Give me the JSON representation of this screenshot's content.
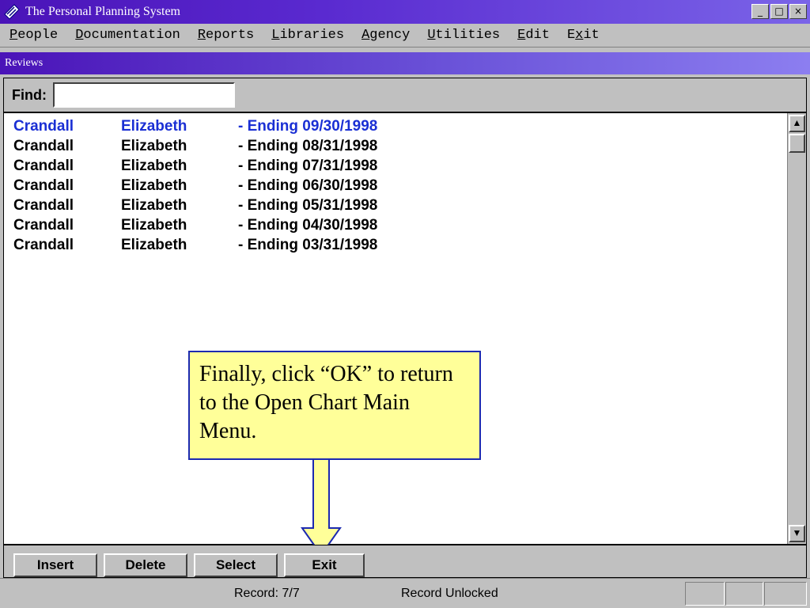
{
  "window": {
    "title": "The Personal Planning System",
    "controls": [
      "_",
      "□",
      "×"
    ]
  },
  "menu": [
    {
      "accel": "P",
      "rest": "eople"
    },
    {
      "accel": "D",
      "rest": "ocumentation"
    },
    {
      "accel": "R",
      "rest": "eports"
    },
    {
      "accel": "L",
      "rest": "ibraries"
    },
    {
      "accel": "A",
      "rest": "gency"
    },
    {
      "accel": "U",
      "rest": "tilities"
    },
    {
      "accel": "E",
      "rest": "dit"
    },
    {
      "pre": "E",
      "accel": "x",
      "rest": "it"
    }
  ],
  "child_window": {
    "title": "Reviews"
  },
  "find": {
    "label": "Find:",
    "value": ""
  },
  "rows": [
    {
      "last": "Crandall",
      "first": "Elizabeth",
      "period": "- Ending 09/30/1998",
      "selected": true
    },
    {
      "last": "Crandall",
      "first": "Elizabeth",
      "period": "- Ending 08/31/1998",
      "selected": false
    },
    {
      "last": "Crandall",
      "first": "Elizabeth",
      "period": "- Ending 07/31/1998",
      "selected": false
    },
    {
      "last": "Crandall",
      "first": "Elizabeth",
      "period": "- Ending 06/30/1998",
      "selected": false
    },
    {
      "last": "Crandall",
      "first": "Elizabeth",
      "period": "- Ending 05/31/1998",
      "selected": false
    },
    {
      "last": "Crandall",
      "first": "Elizabeth",
      "period": "- Ending 04/30/1998",
      "selected": false
    },
    {
      "last": "Crandall",
      "first": "Elizabeth",
      "period": "- Ending 03/31/1998",
      "selected": false
    }
  ],
  "scrollbar": {
    "up": "▲",
    "down": "▼"
  },
  "callout": {
    "text": "Finally, click “OK” to return to the Open Chart Main Menu."
  },
  "buttons": {
    "insert": "Insert",
    "delete": "Delete",
    "select": "Select",
    "exit": "Exit"
  },
  "status": {
    "record": "Record: 7/7",
    "lock": "Record Unlocked"
  },
  "colors": {
    "selected_row": "#1a2fd4",
    "callout_bg": "#ffff99",
    "title_gradient_start": "#4a13b8"
  }
}
